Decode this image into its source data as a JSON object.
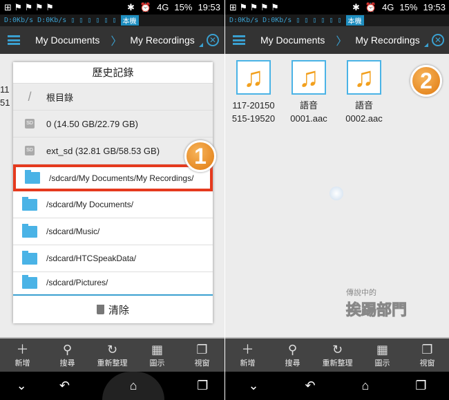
{
  "status": {
    "time": "19:53",
    "battery": "15%",
    "network": "4G"
  },
  "netrow": {
    "speed1": "D:0Kb/s",
    "speed2": "D:0Kb/s",
    "device": "本機"
  },
  "appbar": {
    "crumb1": "My Documents",
    "crumb2": "My Recordings"
  },
  "toolbar": [
    "新增",
    "搜尋",
    "重新整理",
    "圖示",
    "視窗"
  ],
  "dialog": {
    "title": "歷史記錄",
    "items": [
      "根目錄",
      "0 (14.50 GB/22.79 GB)",
      "ext_sd (32.81 GB/58.53 GB)",
      "/sdcard/My Documents/My Recordings/",
      "/sdcard/My Documents/",
      "/sdcard/Music/",
      "/sdcard/HTCSpeakData/",
      "/sdcard/Pictures/"
    ],
    "clear": "清除"
  },
  "files": [
    {
      "l1": "117-20150",
      "l2": "515-19520"
    },
    {
      "l1": "語音",
      "l2": "0001.aac"
    },
    {
      "l1": "語音",
      "l2": "0002.aac"
    }
  ],
  "badges": [
    "1",
    "2"
  ],
  "watermark": {
    "small": "傳說中的",
    "big": "挨踢部門"
  },
  "accent": "#3aa0d0"
}
